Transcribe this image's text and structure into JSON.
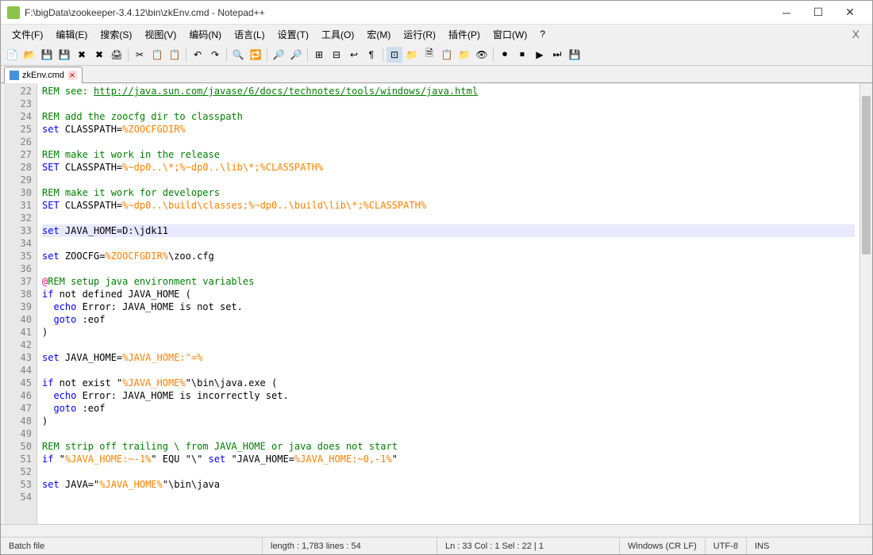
{
  "window": {
    "title": "F:\\bigData\\zookeeper-3.4.12\\bin\\zkEnv.cmd - Notepad++"
  },
  "menu": {
    "file": "文件(F)",
    "edit": "编辑(E)",
    "search": "搜索(S)",
    "view": "视图(V)",
    "encoding": "编码(N)",
    "language": "语言(L)",
    "settings": "设置(T)",
    "tools": "工具(O)",
    "macro": "宏(M)",
    "run": "运行(R)",
    "plugins": "插件(P)",
    "window": "窗口(W)",
    "help": "?"
  },
  "tabs": {
    "t0": {
      "label": "zkEnv.cmd"
    }
  },
  "gutter": [
    "22",
    "23",
    "24",
    "25",
    "26",
    "27",
    "28",
    "29",
    "30",
    "31",
    "32",
    "33",
    "34",
    "35",
    "36",
    "37",
    "38",
    "39",
    "40",
    "41",
    "42",
    "43",
    "44",
    "45",
    "46",
    "47",
    "48",
    "49",
    "50",
    "51",
    "52",
    "53",
    "54"
  ],
  "code": {
    "l22a": "REM see: ",
    "l22b": "http://java.sun.com/javase/6/docs/technotes/tools/windows/java.html",
    "l24a": "REM add the zoocfg dir to classpath",
    "l25a": "set",
    "l25b": " CLASSPATH=",
    "l25c": "%ZOOCFGDIR%",
    "l27a": "REM make it work in the release",
    "l28a": "SET",
    "l28b": " CLASSPATH=",
    "l28c": "%~dp0..\\*;%~dp0..\\lib\\*;%CLASSPATH%",
    "l30a": "REM make it work for developers",
    "l31a": "SET",
    "l31b": " CLASSPATH=",
    "l31c": "%~dp0..\\build\\classes;%~dp0..\\build\\lib\\*;%CLASSPATH%",
    "l33a": "set",
    "l33b": " JAVA_HOME=D:\\jdk11",
    "l35a": "set",
    "l35b": " ZOOCFG=",
    "l35c": "%ZOOCFGDIR%",
    "l35d": "\\zoo.cfg",
    "l37a": "@",
    "l37b": "REM setup java environment variables",
    "l38a": "if",
    "l38b": " not defined JAVA_HOME (",
    "l39a": "  ",
    "l39b": "echo",
    "l39c": " Error: JAVA_HOME is not set.",
    "l40a": "  ",
    "l40b": "goto",
    "l40c": " :eof",
    "l41a": ")",
    "l43a": "set",
    "l43b": " JAVA_HOME=",
    "l43c": "%JAVA_HOME:\"=%",
    "l45a": "if",
    "l45b": " not exist \"",
    "l45c": "%JAVA_HOME%",
    "l45d": "\"\\bin\\java.exe (",
    "l46a": "  ",
    "l46b": "echo",
    "l46c": " Error: JAVA_HOME is incorrectly set.",
    "l47a": "  ",
    "l47b": "goto",
    "l47c": " :eof",
    "l48a": ")",
    "l50a": "REM strip off trailing \\ from JAVA_HOME or java does not start",
    "l51a": "if",
    "l51b": " \"",
    "l51c": "%JAVA_HOME:~-1%",
    "l51d": "\" EQU \"\\\" ",
    "l51e": "set",
    "l51f": " \"JAVA_HOME=",
    "l51g": "%JAVA_HOME:~0,-1%",
    "l51h": "\"",
    "l53a": "set",
    "l53b": " JAVA=\"",
    "l53c": "%JAVA_HOME%",
    "l53d": "\"\\bin\\java"
  },
  "status": {
    "type": "Batch file",
    "length": "length : 1,783    lines : 54",
    "pos": "Ln : 33    Col : 1    Sel : 22 | 1",
    "eol": "Windows (CR LF)",
    "enc": "UTF-8",
    "ins": "INS"
  }
}
